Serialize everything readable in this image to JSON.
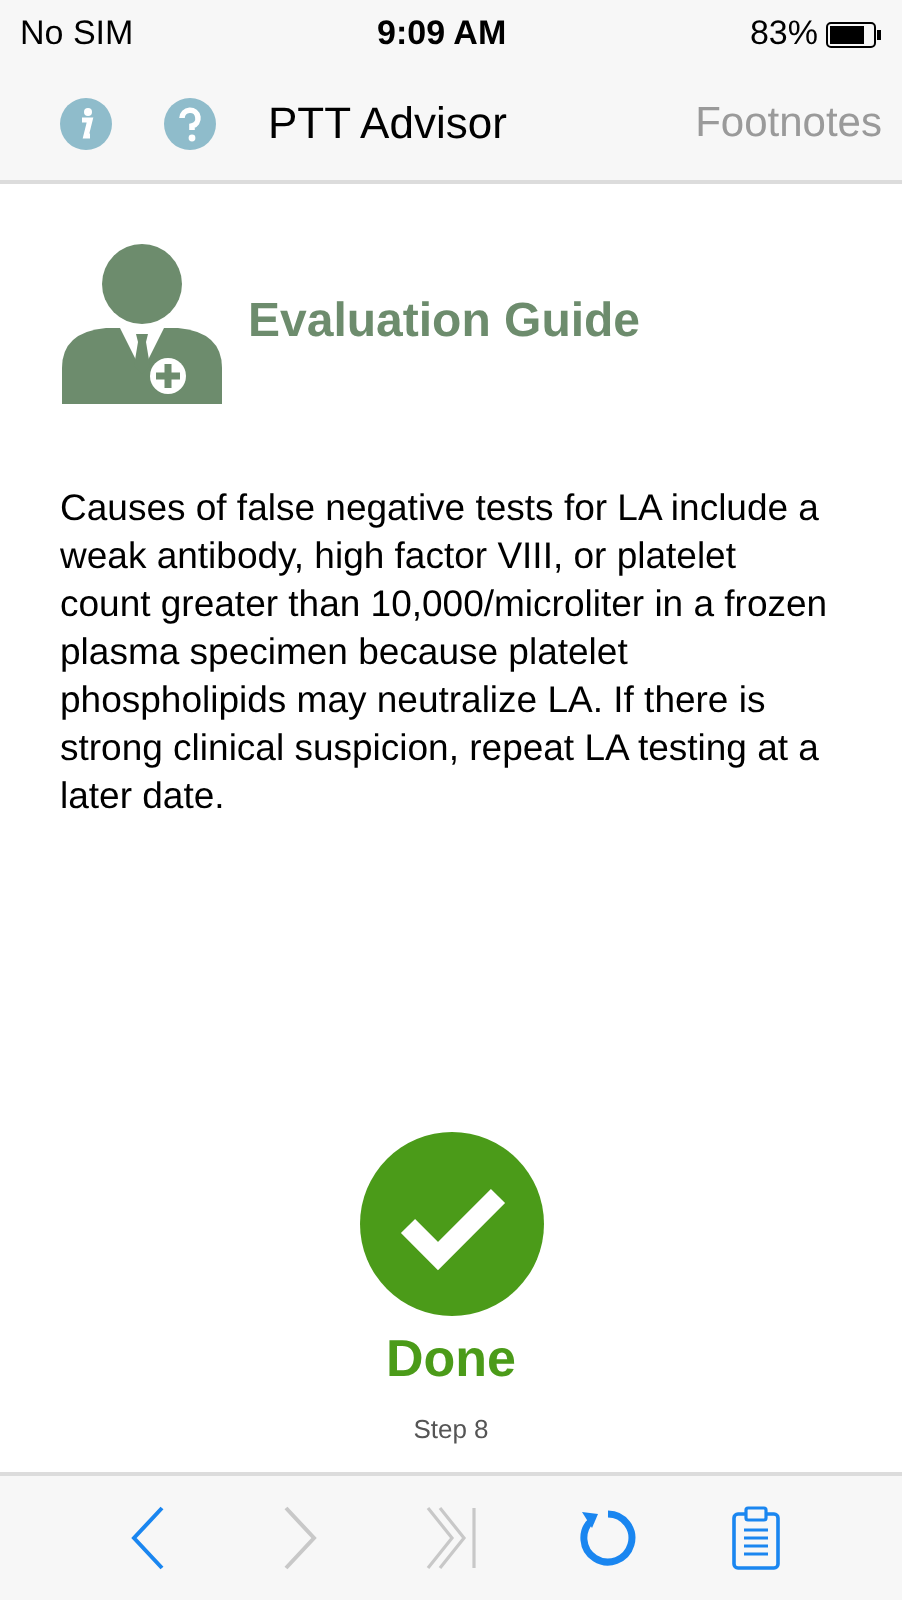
{
  "status_bar": {
    "carrier": "No SIM",
    "time": "9:09 AM",
    "battery": "83%"
  },
  "nav_bar": {
    "title": "PTT Advisor",
    "right_button": {
      "label": "Footnotes",
      "disabled": true
    },
    "left_buttons": [
      {
        "kind": "info"
      },
      {
        "kind": "help"
      }
    ]
  },
  "header": {
    "title": "Evaluation Guide"
  },
  "body": "Causes of false negative tests for LA include a weak antibody, high factor VIII, or platelet count greater than 10,000/microliter in a frozen plasma specimen because platelet phospholipids may neutralize LA. If there is strong clinical suspicion, repeat LA testing at a later date.",
  "result": {
    "label": "Done",
    "step": "Step 8"
  },
  "toolbar": [
    {
      "kind": "back",
      "disabled": false
    },
    {
      "kind": "forward",
      "disabled": true
    },
    {
      "kind": "last",
      "disabled": true
    },
    {
      "kind": "restart",
      "disabled": false
    },
    {
      "kind": "notes",
      "disabled": false
    }
  ]
}
